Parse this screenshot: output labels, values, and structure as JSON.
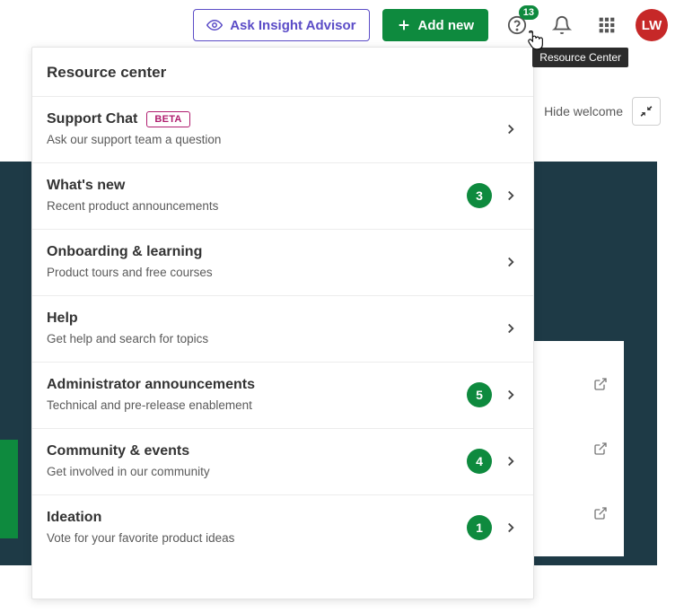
{
  "topbar": {
    "ask_label": "Ask Insight Advisor",
    "add_label": "Add new",
    "help_badge": "13",
    "avatar_initials": "LW",
    "tooltip": "Resource Center"
  },
  "welcome": {
    "hide_label": "Hide welcome"
  },
  "panel": {
    "title": "Resource center",
    "items": [
      {
        "title": "Support Chat",
        "subtitle": "Ask our support team a question",
        "beta": "BETA",
        "count": null
      },
      {
        "title": "What's new",
        "subtitle": "Recent product announcements",
        "beta": null,
        "count": "3"
      },
      {
        "title": "Onboarding & learning",
        "subtitle": "Product tours and free courses",
        "beta": null,
        "count": null
      },
      {
        "title": "Help",
        "subtitle": "Get help and search for topics",
        "beta": null,
        "count": null
      },
      {
        "title": "Administrator announcements",
        "subtitle": "Technical and pre-release enablement",
        "beta": null,
        "count": "5"
      },
      {
        "title": "Community & events",
        "subtitle": "Get involved in our community",
        "beta": null,
        "count": "4"
      },
      {
        "title": "Ideation",
        "subtitle": "Vote for your favorite product ideas",
        "beta": null,
        "count": "1"
      }
    ]
  }
}
